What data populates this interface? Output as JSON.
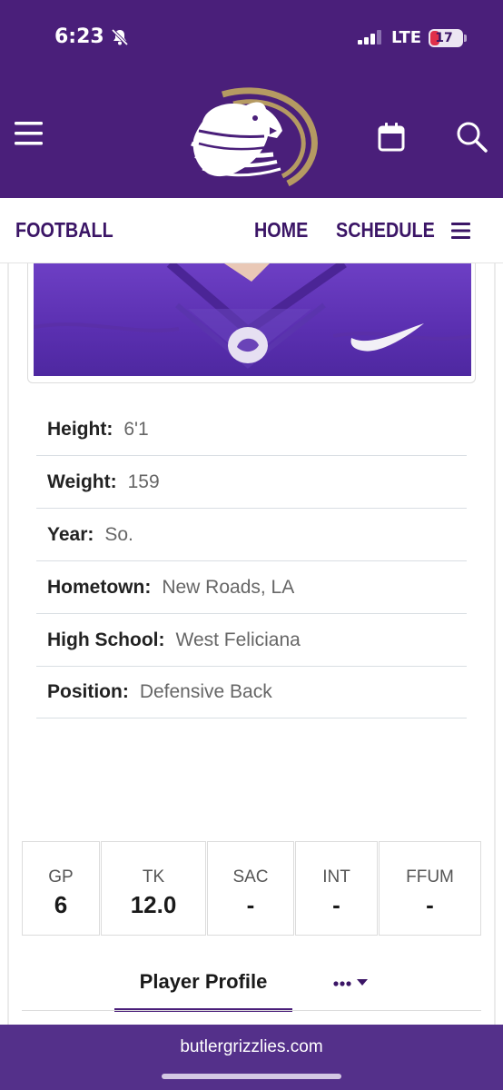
{
  "status_bar": {
    "time": "6:23",
    "network": "LTE",
    "battery": "17",
    "icons": [
      "bell-off-icon",
      "signal-icon",
      "battery-icon"
    ]
  },
  "header": {
    "brand_color": "#4a1f7a",
    "accent_color": "#b59a62",
    "icons": [
      "menu-icon",
      "grizzly-logo",
      "calendar-icon",
      "search-icon"
    ]
  },
  "subnav": {
    "title": "FOOTBALL",
    "home": "HOME",
    "schedule": "SCHEDULE"
  },
  "player_info": [
    {
      "label": "Height:",
      "value": "6'1"
    },
    {
      "label": "Weight:",
      "value": "159"
    },
    {
      "label": "Year:",
      "value": "So."
    },
    {
      "label": "Hometown:",
      "value": "New Roads, LA"
    },
    {
      "label": "High School:",
      "value": "West Feliciana"
    },
    {
      "label": "Position:",
      "value": "Defensive Back"
    }
  ],
  "stats": [
    {
      "label": "GP",
      "value": "6"
    },
    {
      "label": "TK",
      "value": "12.0"
    },
    {
      "label": "SAC",
      "value": "-"
    },
    {
      "label": "INT",
      "value": "-"
    },
    {
      "label": "FFUM",
      "value": "-"
    }
  ],
  "tabs": {
    "active": "Player Profile",
    "more_icon": "ellipsis-dropdown-icon"
  },
  "browser": {
    "url": "butlergrizzlies.com"
  }
}
